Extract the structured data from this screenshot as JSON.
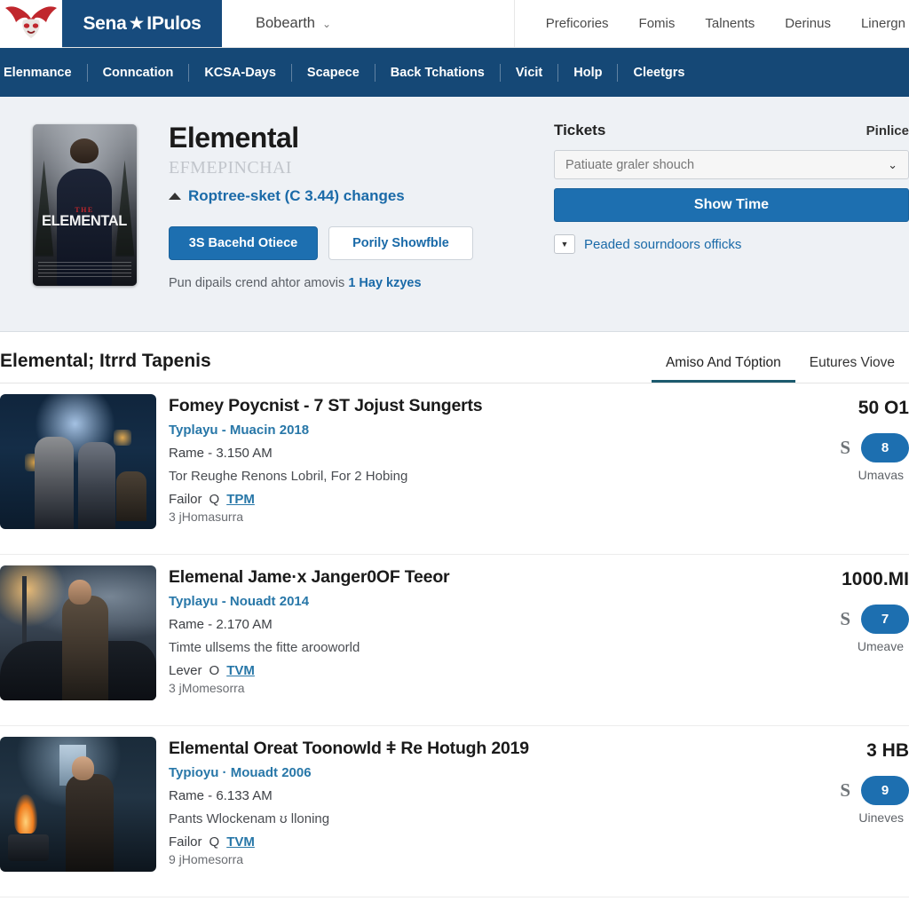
{
  "header": {
    "logo_icon": "eagle-logo-icon",
    "brand_left": "Sena",
    "brand_star_icon": "star-icon",
    "brand_right": "IPulos",
    "account_name": "Bobearth",
    "account_caret_icon": "chevron-down-icon",
    "nav_right": [
      {
        "label": "Preficories"
      },
      {
        "label": "Fomis"
      },
      {
        "label": "Talnents"
      },
      {
        "label": "Derinus"
      },
      {
        "label": "Linergn"
      }
    ]
  },
  "mainnav": {
    "items": [
      {
        "label": "Elenmance"
      },
      {
        "label": "Conncation"
      },
      {
        "label": "KCSA-Days"
      },
      {
        "label": "Scapece"
      },
      {
        "label": "Back Tchations"
      },
      {
        "label": "Vicit"
      },
      {
        "label": "Holp"
      },
      {
        "label": "Cleetgrs"
      }
    ]
  },
  "hero": {
    "poster": {
      "the_label": "THE",
      "title_label": "ELEMENTAL"
    },
    "title": "Elemental",
    "subtitle": "EFMEPINCHAI",
    "rating_icon": "triangle-up-icon",
    "rating_link": "Roptree-sket (C 3.44) changes",
    "primary_button": "3S Bacehd Otiece",
    "outline_button": "Porily Showfble",
    "note_text": "Pun dipails crend ahtor amovis",
    "note_link": "1 Hay kzyes"
  },
  "tickets": {
    "title": "Tickets",
    "right_label": "Pinlice",
    "select_value": "Patiuate graler shouch",
    "select_caret_icon": "chevron-down-icon",
    "showtime_button": "Show Time",
    "mini_dropdown_icon": "caret-down-icon",
    "sub_link": "Peaded sourndoors officks"
  },
  "section": {
    "title": "Elemental; Itrrd Tapenis",
    "tabs": [
      {
        "label": "Amiso And Tóption",
        "active": true
      },
      {
        "label": "Eutures Viove",
        "active": false
      }
    ]
  },
  "list": {
    "items": [
      {
        "thumb_name": "alley-scene-thumbnail",
        "title": "Fomey Poycnist - 7 ST Jojust Sungerts",
        "meta": "Typlayu - Muacin 2018",
        "line1": "Rame - 3.150 AM",
        "line2": "Tor Reughe Renons Lobril, For 2 Hobing",
        "tail_label": "Failor",
        "tail_mid": "Q",
        "tail_link": "TPM",
        "sub": "3 jHomasurra",
        "price": "50 O1",
        "s_glyph": "S",
        "badge": "8",
        "badge_label": "Umavas"
      },
      {
        "thumb_name": "man-by-car-thumbnail",
        "title": "Elemenal Jamе·x Janger0OF Teeor",
        "meta": "Typlayu - Nouadt 2014",
        "line1": "Rame - 2.170 AM",
        "line2": "Timte ullsems the fitte arooworld",
        "tail_label": "Lever",
        "tail_mid": "O",
        "tail_link": "TVM",
        "sub": "3 jMomesorra",
        "price": "1000.MI",
        "s_glyph": "S",
        "badge": "7",
        "badge_label": "Umeave"
      },
      {
        "thumb_name": "man-with-fire-thumbnail",
        "title": "Elemental Oreat Toonowld ǂ Re Hotugh 2019",
        "meta": "Typioyu · Mouadt 2006",
        "line1": "Rame - 6.133 AM",
        "line2": "Pants Wlockenam ʊ lloning",
        "tail_label": "Failor",
        "tail_mid": "Q",
        "tail_link": "TVM",
        "sub": "9 jHomesorra",
        "price": "3 HB",
        "s_glyph": "S",
        "badge": "9",
        "badge_label": "Uineves"
      }
    ]
  },
  "colors": {
    "brand_blue": "#174b7d",
    "nav_blue": "#154876",
    "accent_blue": "#1d6fb0",
    "link_blue": "#1a6aa8",
    "hero_bg": "#eef1f5",
    "tab_active": "#1c5a6e"
  }
}
